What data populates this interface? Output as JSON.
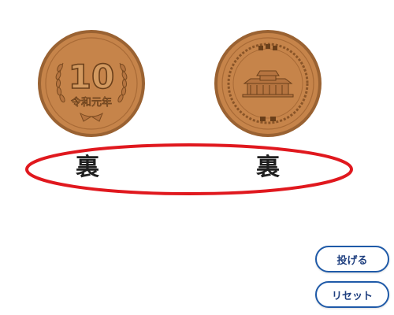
{
  "coins": {
    "left": {
      "face": "front",
      "denomination": "10",
      "era_text": "令和元年",
      "result": "裏"
    },
    "right": {
      "face": "back",
      "inscription_top": "日本国",
      "inscription_bottom": "十円",
      "result": "裏"
    }
  },
  "buttons": {
    "throw_label": "投げる",
    "reset_label": "リセット"
  },
  "colors": {
    "coin_fill": "#c6844a",
    "coin_rim": "#9a6232",
    "coin_dark": "#6a3f1a",
    "ellipse_stroke": "#e0181e",
    "button_border": "#1f5aa8"
  }
}
